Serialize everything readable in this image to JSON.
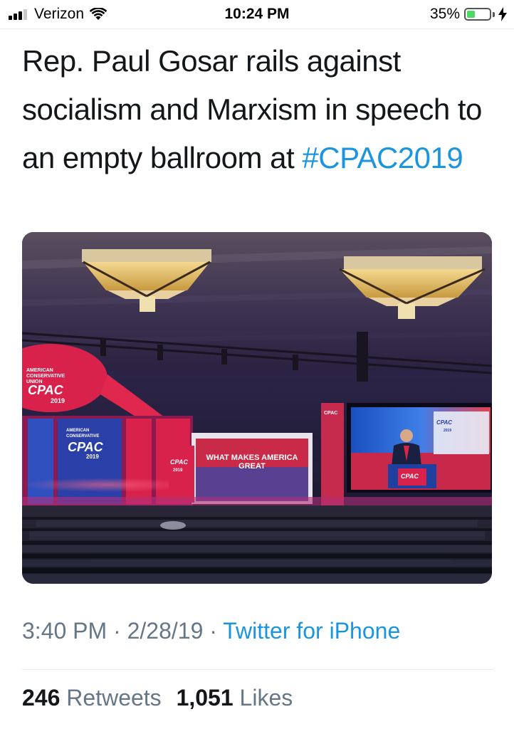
{
  "status_bar": {
    "carrier": "Verizon",
    "time": "10:24 PM",
    "battery_percent": "35%",
    "battery_level": 0.35,
    "signal_bars": 4,
    "signal_bars_filled": 3,
    "icons": [
      "signal-icon",
      "wifi-icon",
      "battery-icon",
      "charging-bolt-icon"
    ]
  },
  "tweet": {
    "text_plain": "Rep. Paul Gosar rails against socialism and Marxism in speech to an empty ballroom at ",
    "hashtag": "#CPAC2019",
    "photo": {
      "signs": {
        "org_line1": "AMERICAN",
        "org_line2": "CONSERVATIVE",
        "org_line3": "UNION",
        "logo": "CPAC",
        "year": "2019",
        "stage_banner_line1": "WHAT MAKES AMERICA",
        "stage_banner_line2": "GREAT"
      }
    },
    "time": "3:40 PM",
    "separator": "·",
    "date": "2/28/19",
    "source": "Twitter for iPhone",
    "retweets_count": "246",
    "retweets_label": "Retweets",
    "likes_count": "1,051",
    "likes_label": "Likes"
  },
  "colors": {
    "link_blue": "#1b95e0",
    "text_primary": "#14171a",
    "text_secondary": "#657786",
    "battery_green": "#4cd964"
  }
}
